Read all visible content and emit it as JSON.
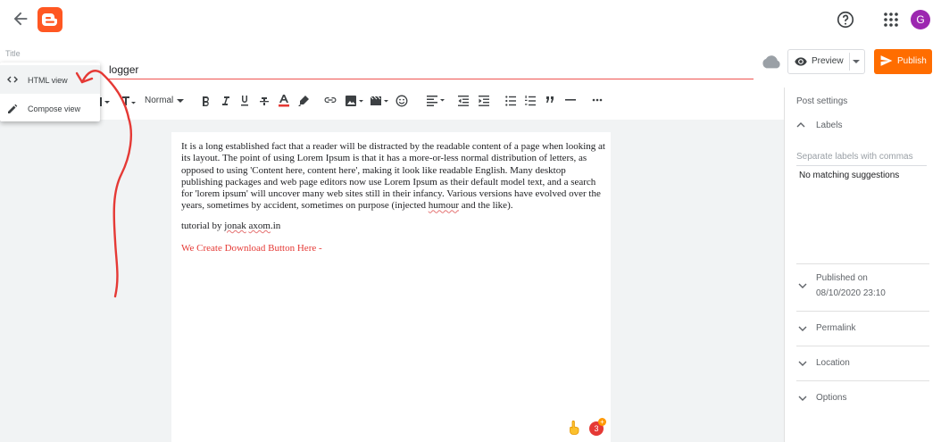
{
  "header": {
    "avatar_initial": "G"
  },
  "title": {
    "label": "Title",
    "value": "logger"
  },
  "actions": {
    "preview_label": "Preview",
    "publish_label": "Publish"
  },
  "toolbar": {
    "paragraph_style": "Normal"
  },
  "mode_menu": {
    "items": [
      {
        "label": "HTML view",
        "icon": "code-icon"
      },
      {
        "label": "Compose view",
        "icon": "pencil-icon"
      }
    ]
  },
  "editor": {
    "paragraph_1": "It is a long established fact that a reader will be distracted by the readable content of a page when looking at its layout. The point of using Lorem Ipsum is that it has a more-or-less normal distribution of letters, as opposed to using 'Content here, content here', making it look like readable English. Many desktop publishing packages and web page editors now use Lorem Ipsum as their default model text, and a search for 'lorem ipsum' will uncover many web sites still in their infancy. Various versions have evolved over the years, sometimes by accident, sometimes on purpose (injected ",
    "paragraph_1_word": "humour",
    "paragraph_1_end": " and the like).",
    "paragraph_2_start": "tutorial by ",
    "paragraph_2_word1": "jonak",
    "paragraph_2_space": " ",
    "paragraph_2_word2": "axom",
    "paragraph_2_end": ".in",
    "paragraph_3": "We Create Download Button Here -",
    "notification_count": "3",
    "notification_plus": "+"
  },
  "settings": {
    "title": "Post settings",
    "labels_heading": "Labels",
    "labels_placeholder": "Separate labels with commas",
    "no_match": "No matching suggestions",
    "published_label": "Published on",
    "published_date": "08/10/2020 23:10",
    "permalink": "Permalink",
    "location": "Location",
    "options": "Options"
  },
  "colors": {
    "brand": "#ff5722",
    "publish": "#ff6d00",
    "avatar": "#9c27b0",
    "annotation_arrow": "#e53935"
  }
}
